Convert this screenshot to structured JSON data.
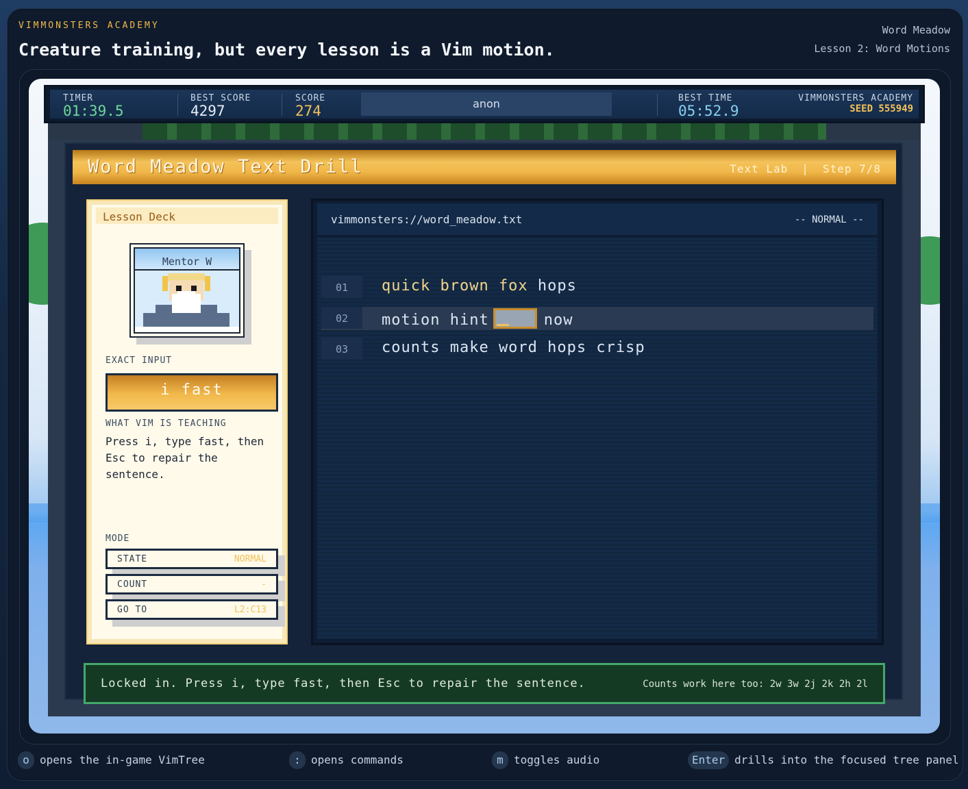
{
  "header": {
    "brand": "VIMMONSTERS ACADEMY",
    "headline": "Creature training, but every lesson is a Vim motion.",
    "world": "Word Meadow",
    "lesson": "Lesson 2: Word Motions"
  },
  "hud": {
    "timer_label": "TIMER",
    "timer_value": "01:39.5",
    "best_score_label": "BEST SCORE",
    "best_score_value": "4297",
    "score_label": "SCORE",
    "score_value": "274",
    "player_name": "anon",
    "best_time_label": "BEST TIME",
    "best_time_value": "05:52.9",
    "academy_label": "VIMMONSTERS ACADEMY",
    "seed": "SEED 555949"
  },
  "drill": {
    "title": "Word Meadow Text Drill",
    "area": "Text Lab",
    "separator": "|",
    "step": "Step 7/8"
  },
  "deck": {
    "title": "Lesson Deck",
    "mentor": "Mentor W",
    "exact_input_label": "EXACT INPUT",
    "exact_input": "i fast",
    "teaching_label": "WHAT VIM IS TEACHING",
    "teaching_text": "Press i, type fast, then Esc to repair the sentence.",
    "mode_label": "MODE",
    "rows": [
      {
        "key": "STATE",
        "value": "NORMAL"
      },
      {
        "key": "COUNT",
        "value": "-"
      },
      {
        "key": "GO TO",
        "value": "L2:C13"
      }
    ]
  },
  "editor": {
    "filename": "vimmonsters://word_meadow.txt",
    "mode": "-- NORMAL --",
    "lines": [
      {
        "num": "01",
        "hl": "quick brown fox",
        "rest": " hops"
      },
      {
        "num": "02",
        "before": "motion hint",
        "after": "now"
      },
      {
        "num": "03",
        "text": "counts make word hops crisp"
      }
    ]
  },
  "status": {
    "message": "Locked in. Press i, type fast, then Esc to repair the sentence.",
    "hint": "Counts work here too: 2w 3w 2j 2k 2h 2l"
  },
  "footer": [
    {
      "key": "o",
      "text": "opens the in-game VimTree"
    },
    {
      "key": ":",
      "text": "opens commands"
    },
    {
      "key": "m",
      "text": "toggles audio"
    },
    {
      "key": "Enter",
      "text": "drills into the focused tree panel"
    }
  ],
  "colors": {
    "accent_gold": "#f2b94a",
    "status_green": "#46a86a",
    "timer_green": "#6fd89a"
  }
}
